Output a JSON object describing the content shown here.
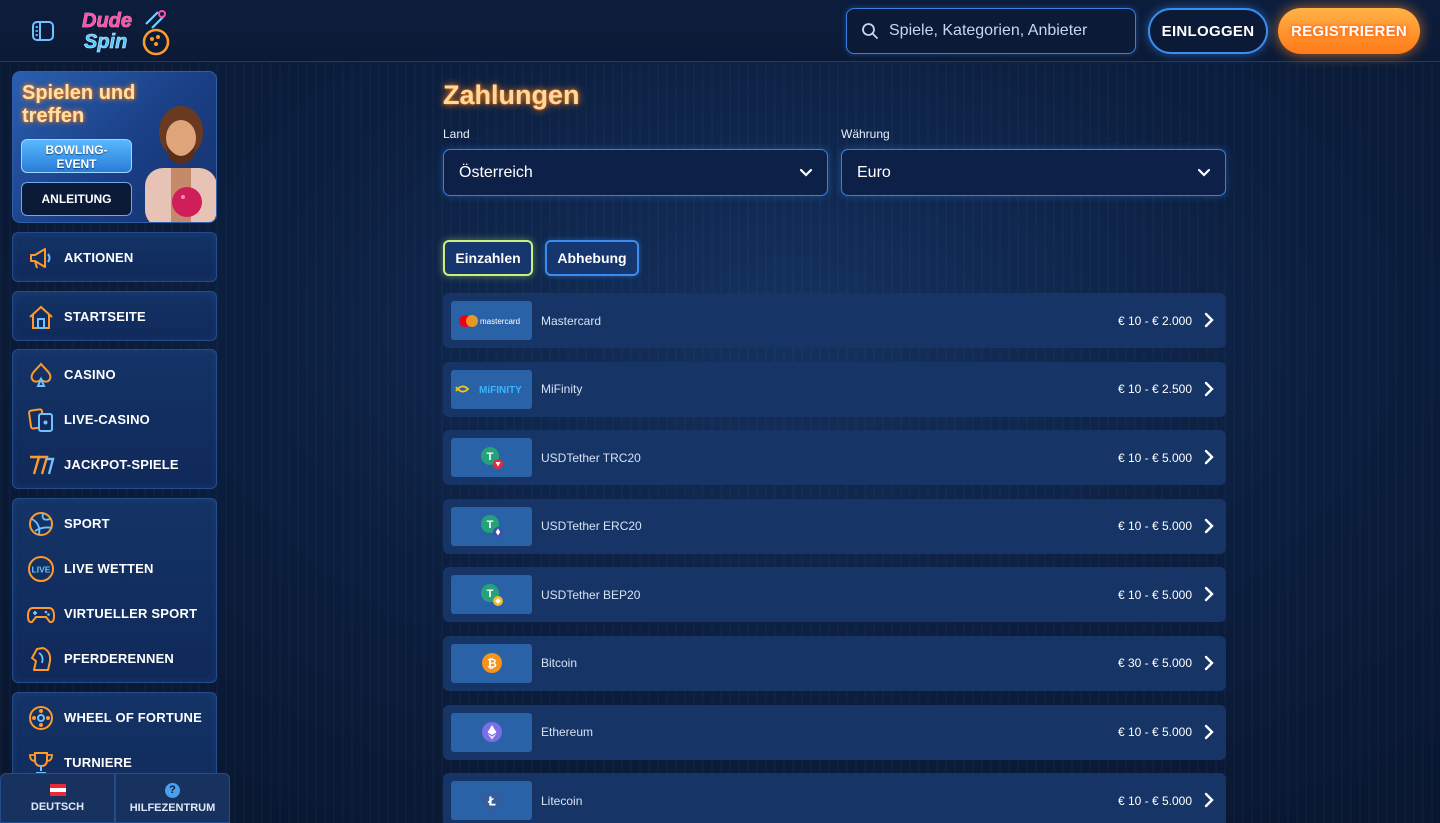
{
  "brand": {
    "logo_line1": "Dude",
    "logo_line2": "Spin"
  },
  "header": {
    "search_placeholder": "Spiele, Kategorien, Anbieter",
    "login_label": "EINLOGGEN",
    "register_label": "REGISTRIEREN"
  },
  "sidebar": {
    "promo": {
      "title": "Spielen und treffen",
      "badge_line1": "BOWLING-",
      "badge_line2": "EVENT",
      "guide_label": "ANLEITUNG"
    },
    "groups": [
      {
        "items": [
          {
            "label": "AKTIONEN",
            "icon": "megaphone-icon"
          }
        ]
      },
      {
        "items": [
          {
            "label": "STARTSEITE",
            "icon": "home-icon"
          }
        ]
      },
      {
        "items": [
          {
            "label": "CASINO",
            "icon": "spade-icon"
          },
          {
            "label": "LIVE-CASINO",
            "icon": "cards-icon"
          },
          {
            "label": "JACKPOT-SPIELE",
            "icon": "sevens-icon"
          }
        ]
      },
      {
        "items": [
          {
            "label": "SPORT",
            "icon": "ball-icon"
          },
          {
            "label": "LIVE WETTEN",
            "icon": "live-icon",
            "icon_text": "LIVE"
          },
          {
            "label": "VIRTUELLER SPORT",
            "icon": "gamepad-icon"
          },
          {
            "label": "PFERDERENNEN",
            "icon": "horse-icon"
          }
        ]
      },
      {
        "items": [
          {
            "label": "WHEEL OF FORTUNE",
            "icon": "wheel-icon"
          },
          {
            "label": "TURNIERE",
            "icon": "trophy-icon"
          }
        ]
      }
    ],
    "footer": {
      "language_label": "DEUTSCH",
      "help_label": "HILFEZENTRUM",
      "help_glyph": "?"
    }
  },
  "main": {
    "title": "Zahlungen",
    "country": {
      "label": "Land",
      "value": "Österreich"
    },
    "currency": {
      "label": "Währung",
      "value": "Euro"
    },
    "tabs": {
      "deposit": "Einzahlen",
      "withdraw": "Abhebung"
    },
    "methods": [
      {
        "name": "Mastercard",
        "range": "€ 10 - € 2.000",
        "logo": "mastercard",
        "logo_text": "mastercard"
      },
      {
        "name": "MiFinity",
        "range": "€ 10 - € 2.500",
        "logo": "mifinity",
        "logo_text": "MiFINITY"
      },
      {
        "name": "USDTether TRC20",
        "range": "€ 10 - € 5.000",
        "logo": "tether-trc20",
        "logo_text": "T"
      },
      {
        "name": "USDTether ERC20",
        "range": "€ 10 - € 5.000",
        "logo": "tether-erc20",
        "logo_text": "T"
      },
      {
        "name": "USDTether BEP20",
        "range": "€ 10 - € 5.000",
        "logo": "tether-bep20",
        "logo_text": "T"
      },
      {
        "name": "Bitcoin",
        "range": "€ 30 - € 5.000",
        "logo": "bitcoin",
        "logo_text": "₿"
      },
      {
        "name": "Ethereum",
        "range": "€ 10 - € 5.000",
        "logo": "ethereum",
        "logo_text": ""
      },
      {
        "name": "Litecoin",
        "range": "€ 10 - € 5.000",
        "logo": "litecoin",
        "logo_text": "Ł"
      }
    ]
  },
  "colors": {
    "accent_blue": "#3a8cf0",
    "register_orange": "#ff8a1a",
    "title_glow": "#ff8a1a",
    "active_tab_border": "#c8f07a",
    "row_bg": "#163566",
    "logo_box": "#2a62a8"
  }
}
